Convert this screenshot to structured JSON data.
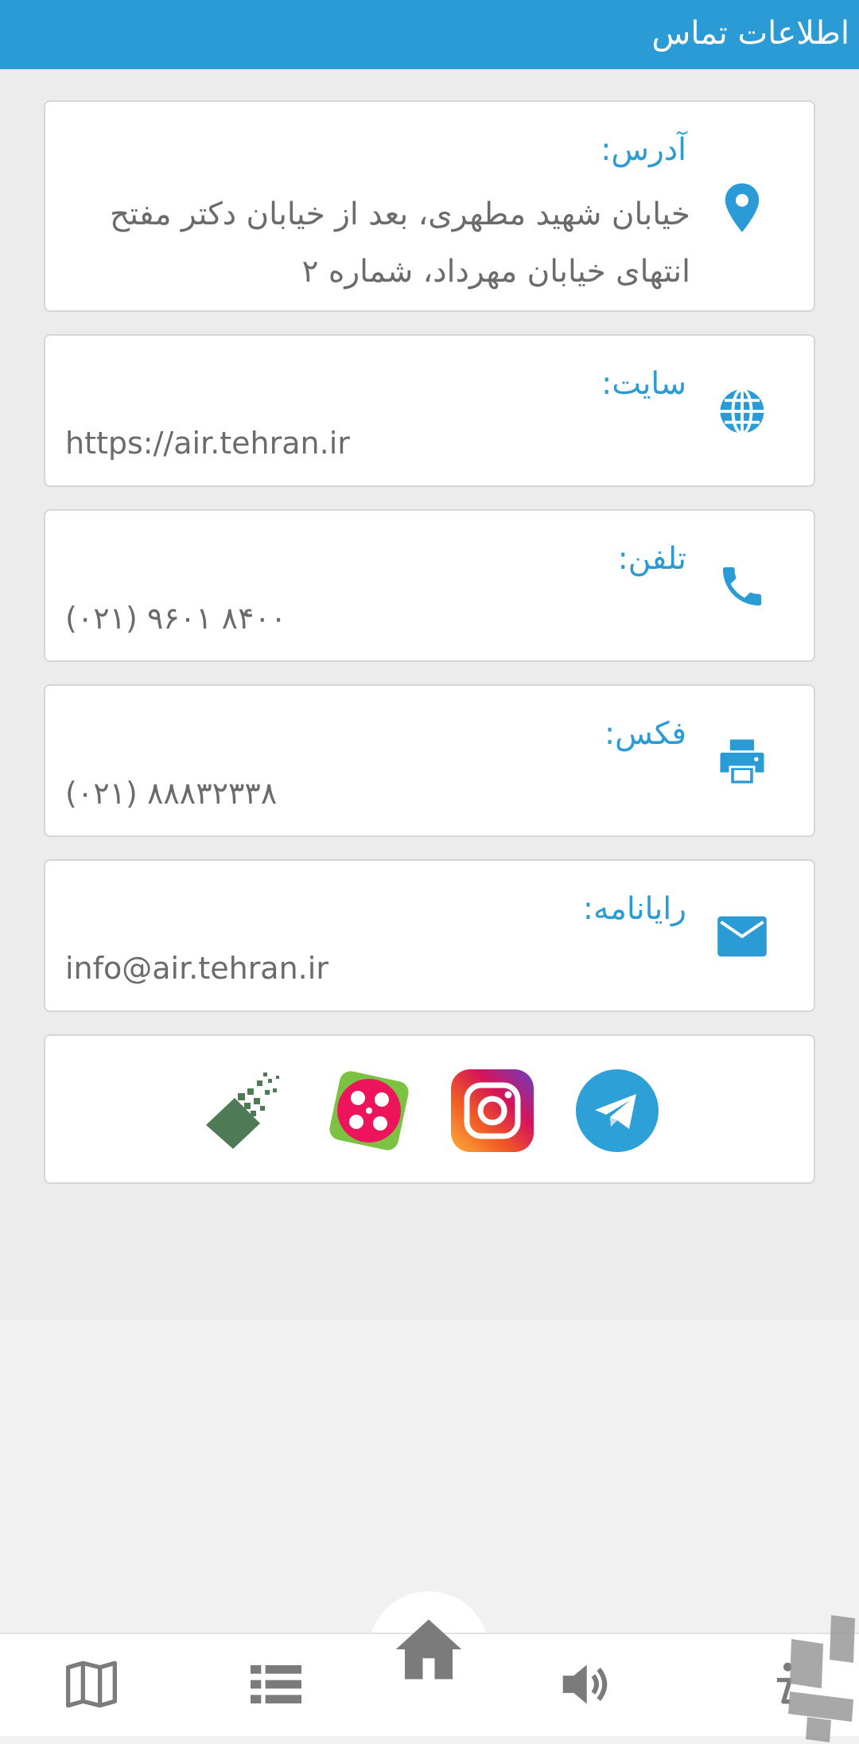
{
  "header": {
    "title": "اطلاعات تماس"
  },
  "address": {
    "label": "آدرس:",
    "value": "خیابان شهید مطهری، بعد از خیابان دکتر مفتح انتهای خیابان مهرداد، شماره ۲",
    "icon": "location-pin-icon"
  },
  "site": {
    "label": "سایت:",
    "value": "https://air.tehran.ir",
    "icon": "globe-icon"
  },
  "phone": {
    "label": "تلفن:",
    "value": "(۰۲۱) ۹۶۰۱ ۸۴۰۰",
    "icon": "phone-icon"
  },
  "fax": {
    "label": "فکس:",
    "value": "(۰۲۱) ۸۸۸۳۲۳۳۸",
    "icon": "printer-icon"
  },
  "email": {
    "label": "رایانامه:",
    "value": "info@air.tehran.ir",
    "icon": "mail-icon"
  },
  "social": [
    "telegram-icon",
    "instagram-icon",
    "aparat-icon",
    "data-portal-icon"
  ],
  "bottom_nav": [
    "info-icon",
    "volume-icon",
    "home-icon",
    "list-icon",
    "map-icon"
  ],
  "colors": {
    "accent": "#2a9bd4",
    "text": "#6b6b6b",
    "background": "#ececec"
  }
}
